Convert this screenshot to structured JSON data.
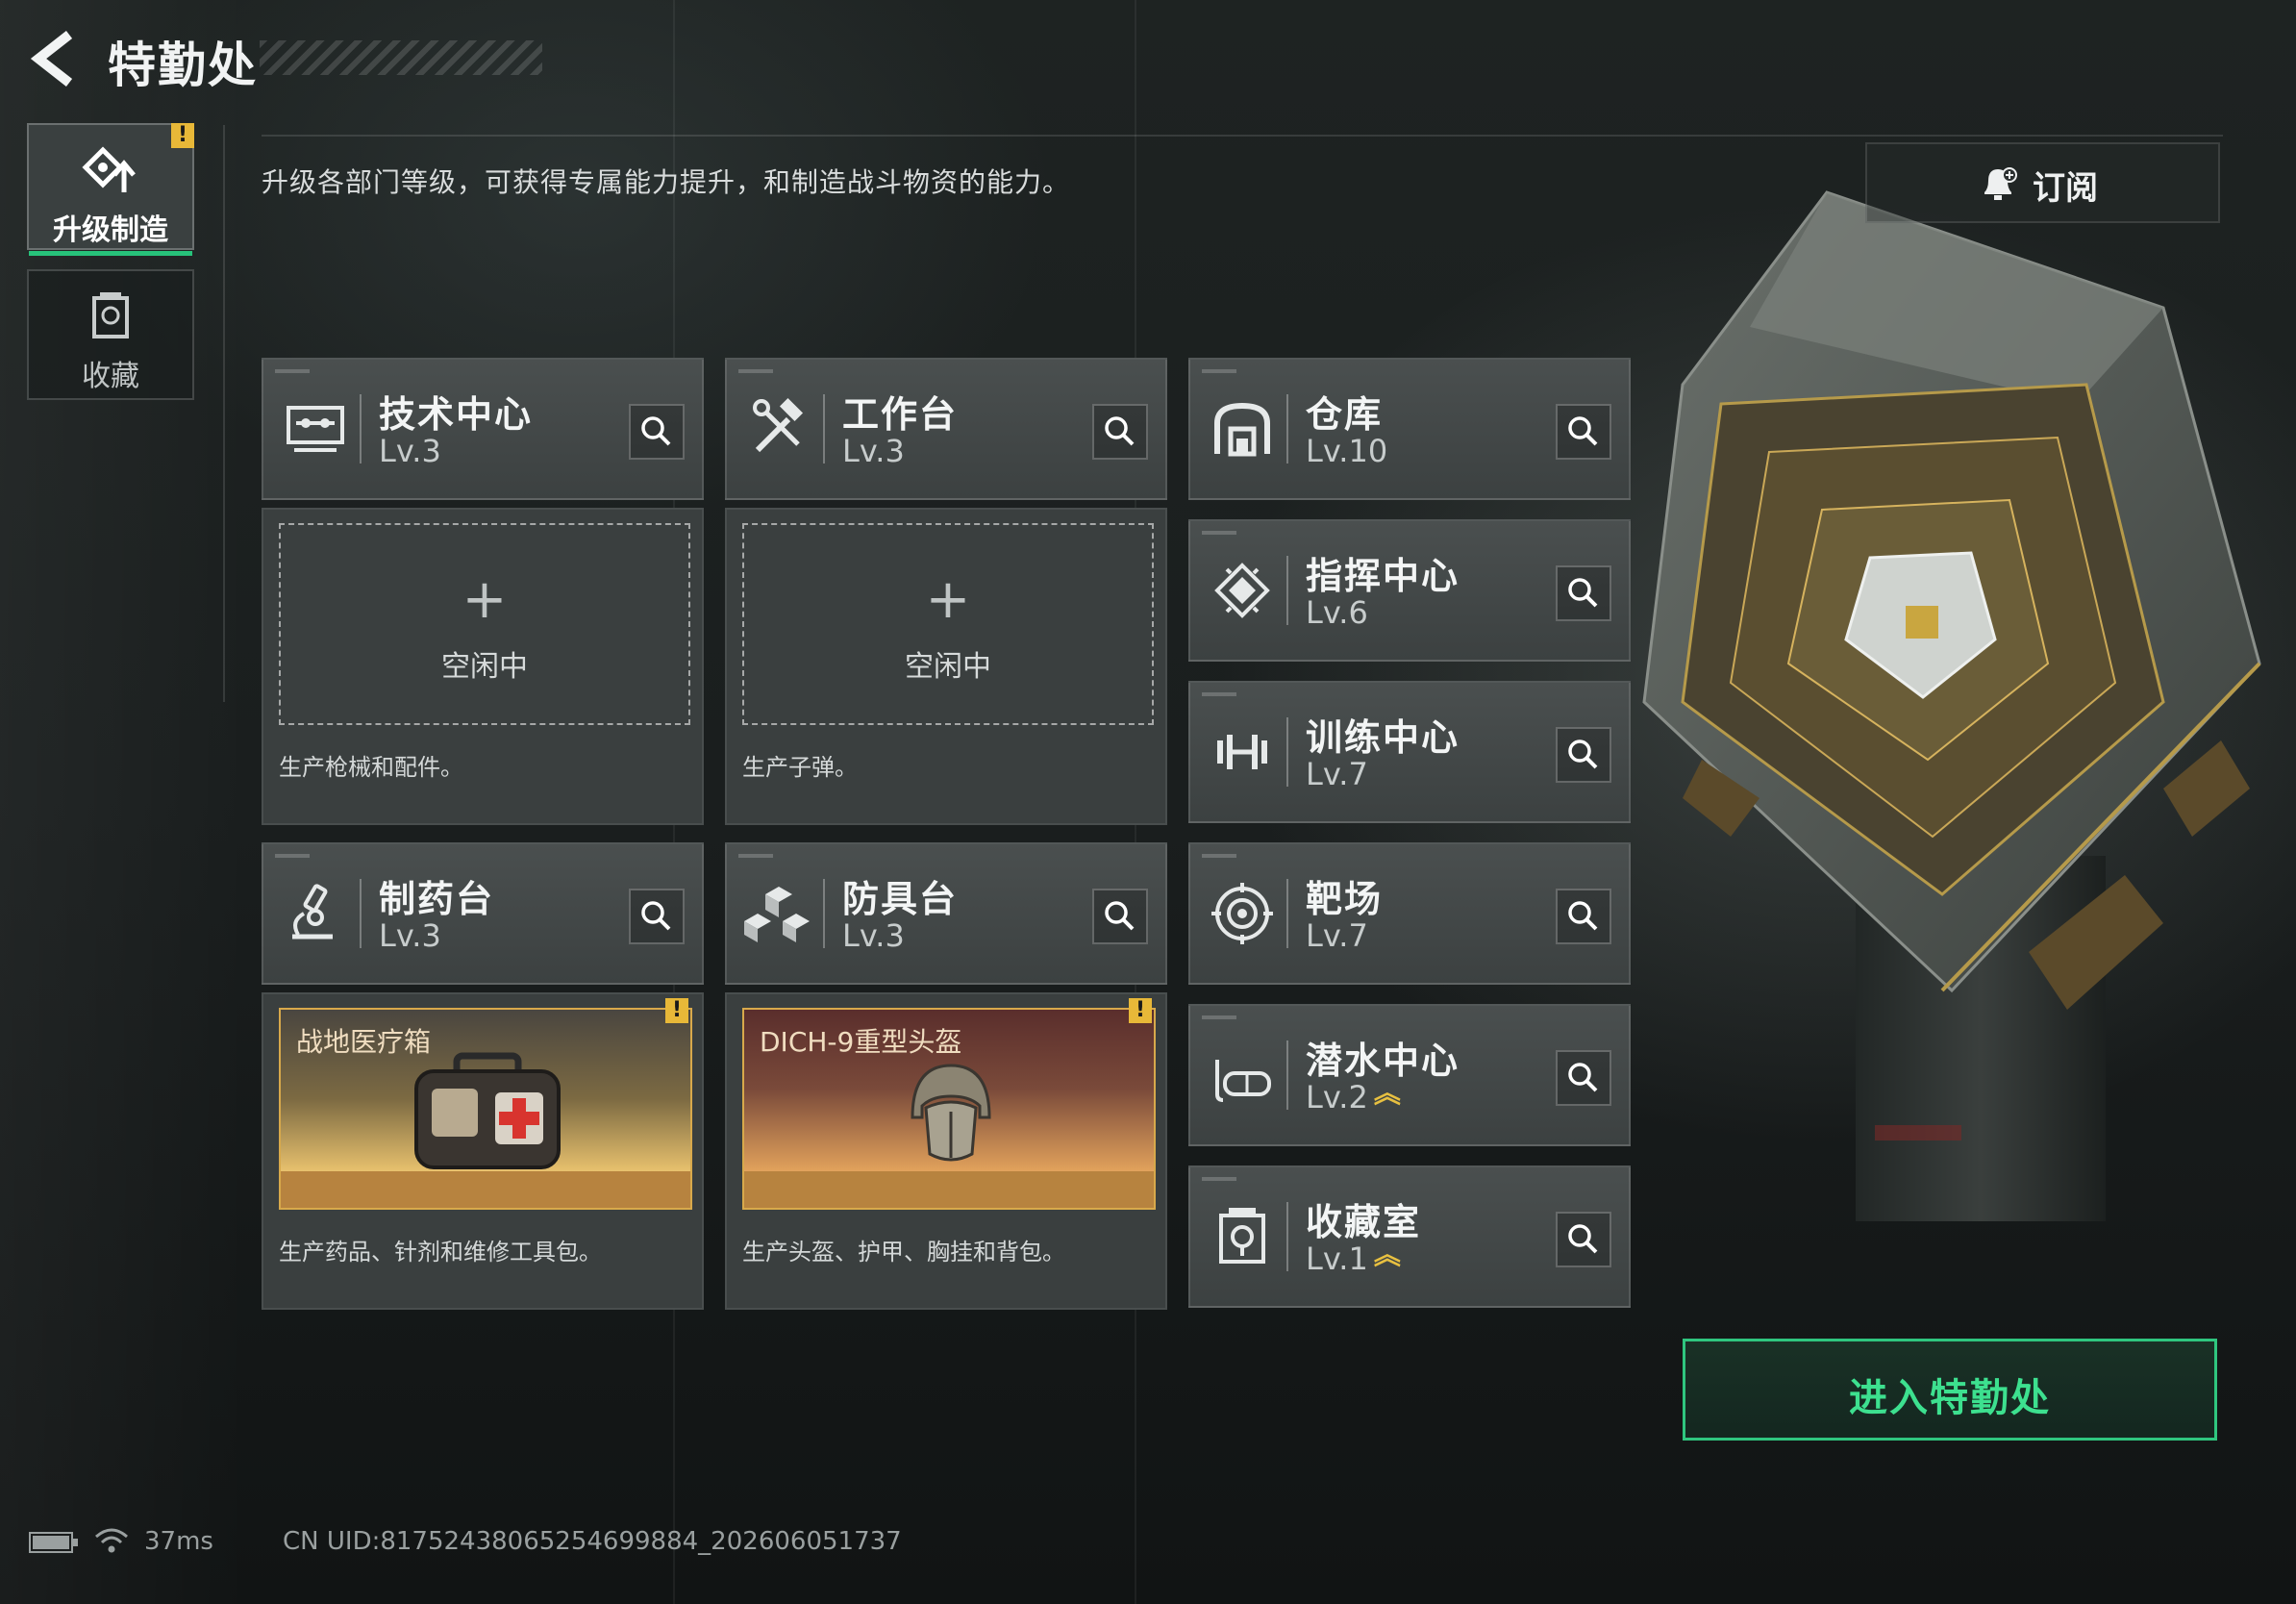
{
  "header": {
    "title": "特勤处"
  },
  "sidebar": {
    "items": [
      {
        "label": "升级制造",
        "active": true,
        "alert": "!"
      },
      {
        "label": "收藏",
        "active": false
      }
    ]
  },
  "description": "升级各部门等级，可获得专属能力提升，和制造战斗物资的能力。",
  "subscribe_label": "订阅",
  "departments": [
    {
      "name": "技术中心",
      "level": "Lv.3",
      "icon": "monitor-icon"
    },
    {
      "name": "工作台",
      "level": "Lv.3",
      "icon": "tools-icon"
    },
    {
      "name": "仓库",
      "level": "Lv.10",
      "icon": "warehouse-icon"
    },
    {
      "name": "指挥中心",
      "level": "Lv.6",
      "icon": "chip-icon"
    },
    {
      "name": "训练中心",
      "level": "Lv.7",
      "icon": "dumbbell-icon"
    },
    {
      "name": "制药台",
      "level": "Lv.3",
      "icon": "microscope-icon"
    },
    {
      "name": "防具台",
      "level": "Lv.3",
      "icon": "blocks-icon"
    },
    {
      "name": "靶场",
      "level": "Lv.7",
      "icon": "target-icon"
    },
    {
      "name": "潜水中心",
      "level": "Lv.2",
      "icon": "goggles-icon",
      "upgradable": true
    },
    {
      "name": "收藏室",
      "level": "Lv.1",
      "icon": "collection-icon",
      "upgradable": true
    }
  ],
  "production": {
    "tech_center": {
      "status": "空闲中",
      "note": "生产枪械和配件。"
    },
    "workbench": {
      "status": "空闲中",
      "note": "生产子弹。"
    },
    "pharmacy": {
      "item": "战地医疗箱",
      "note": "生产药品、针剂和维修工具包。",
      "alert": "!"
    },
    "armor": {
      "item": "DICH-9重型头盔",
      "note": "生产头盔、护甲、胸挂和背包。",
      "alert": "!"
    }
  },
  "enter_label": "进入特勤处",
  "status_bar": {
    "ping": "37ms",
    "uid": "CN UID:81752438065254699884_202606051737"
  },
  "colors": {
    "accent": "#2fc67f",
    "alert": "#e8b838",
    "production_border": "#d8a94b"
  }
}
